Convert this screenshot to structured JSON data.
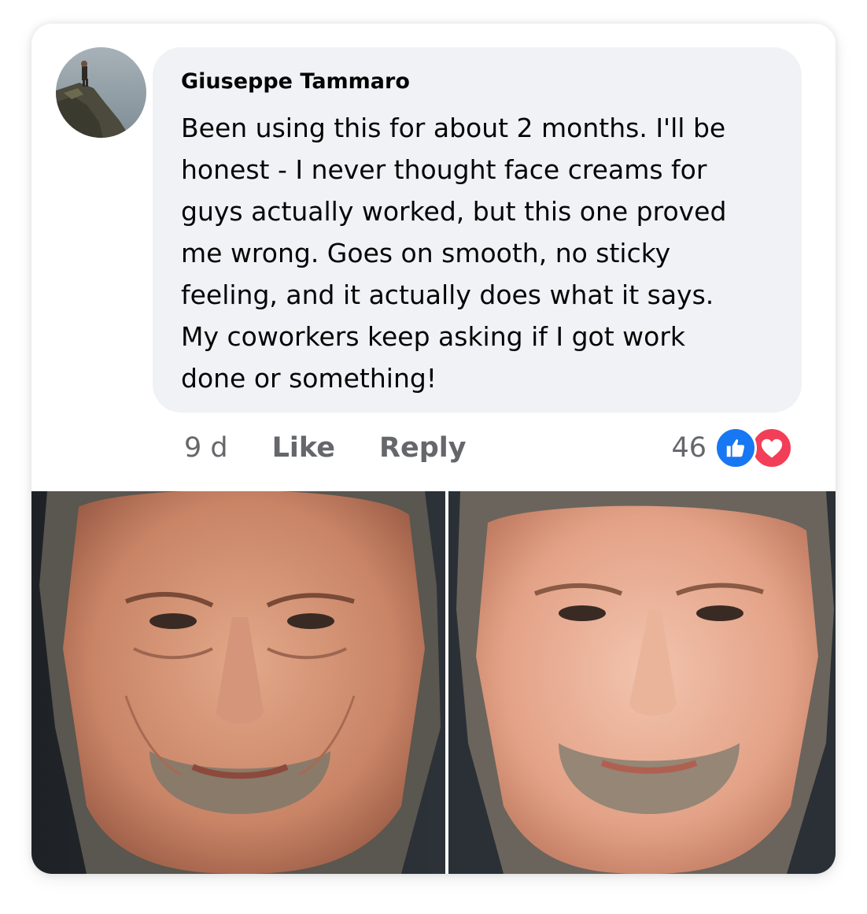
{
  "comment": {
    "author": "Giuseppe Tammaro",
    "lines": [
      "Been using this for about 2 months. I'll be",
      "honest - I never thought face creams for",
      "guys actually worked, but this one proved",
      "me wrong. Goes on smooth, no sticky",
      "feeling, and it actually does what it says.",
      "My coworkers keep asking if I got work",
      "done or something!"
    ],
    "timestamp": "9 d",
    "like_label": "Like",
    "reply_label": "Reply",
    "reaction_count": "46",
    "reactions": [
      "like-icon",
      "love-icon"
    ]
  },
  "colors": {
    "bubble": "#f0f2f5",
    "meta_text": "#65676b",
    "like_blue": "#1877f2",
    "love_red": "#f33e58"
  },
  "avatar_icon": "profile-photo-cliff",
  "attached_image": "before-after-face-photo"
}
